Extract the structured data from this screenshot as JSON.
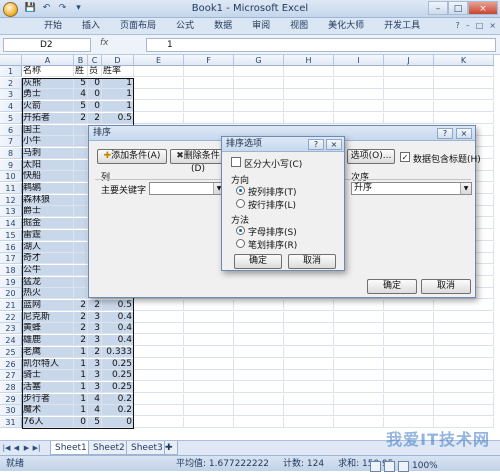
{
  "window": {
    "title": "Book1 - Microsoft Excel",
    "controls": [
      "–",
      "□",
      "×"
    ]
  },
  "qat": [
    "💾",
    "↶",
    "↷",
    "▾"
  ],
  "ribbon": {
    "tabs": [
      "开始",
      "插入",
      "页面布局",
      "公式",
      "数据",
      "审阅",
      "视图",
      "美化大师",
      "开发工具"
    ],
    "right_icons": [
      "?",
      "–",
      "□",
      "×"
    ]
  },
  "formula_bar": {
    "name_box": "D2",
    "fx": "fx",
    "value": "1"
  },
  "sheet": {
    "columns": [
      "A",
      "B",
      "C",
      "D",
      "E",
      "F",
      "G",
      "H",
      "I",
      "J",
      "K"
    ],
    "header_row": [
      "名称",
      "胜",
      "员",
      "胜率"
    ],
    "rows": [
      [
        "灰熊",
        "5",
        "0",
        "1"
      ],
      [
        "勇士",
        "4",
        "0",
        "1"
      ],
      [
        "火箭",
        "5",
        "0",
        "1"
      ],
      [
        "开拓者",
        "2",
        "2",
        "0.5"
      ],
      [
        "国王",
        "",
        "",
        ""
      ],
      [
        "小牛",
        "",
        "",
        ""
      ],
      [
        "马刺",
        "",
        "",
        ""
      ],
      [
        "太阳",
        "",
        "",
        ""
      ],
      [
        "快船",
        "",
        "",
        ""
      ],
      [
        "鹈鹕",
        "",
        "",
        ""
      ],
      [
        "森林狼",
        "",
        "",
        ""
      ],
      [
        "爵士",
        "",
        "",
        ""
      ],
      [
        "掘金",
        "",
        "",
        ""
      ],
      [
        "雷霆",
        "",
        "",
        ""
      ],
      [
        "湖人",
        "",
        "",
        ""
      ],
      [
        "奇才",
        "",
        "",
        ""
      ],
      [
        "公牛",
        "",
        "",
        ""
      ],
      [
        "猛龙",
        "",
        "",
        ""
      ],
      [
        "热火",
        "",
        "",
        ""
      ],
      [
        "篮网",
        "2",
        "2",
        "0.5"
      ],
      [
        "尼克斯",
        "2",
        "3",
        "0.4"
      ],
      [
        "黄蜂",
        "2",
        "3",
        "0.4"
      ],
      [
        "雄鹿",
        "2",
        "3",
        "0.4"
      ],
      [
        "老鹰",
        "1",
        "2",
        "0.333"
      ],
      [
        "凯尔特人",
        "1",
        "3",
        "0.25"
      ],
      [
        "骑士",
        "1",
        "3",
        "0.25"
      ],
      [
        "活塞",
        "1",
        "3",
        "0.25"
      ],
      [
        "步行者",
        "1",
        "4",
        "0.2"
      ],
      [
        "魔术",
        "1",
        "4",
        "0.2"
      ],
      [
        "76人",
        "0",
        "5",
        "0"
      ]
    ],
    "tabs": [
      "Sheet1",
      "Sheet2",
      "Sheet3"
    ]
  },
  "status": {
    "mode": "就绪",
    "average": "平均值: 1.677222222",
    "count": "计数: 124",
    "sum": "求和: 150.95",
    "zoom": "100%"
  },
  "sort_dialog": {
    "title": "排序",
    "add_level": "添加条件(A)",
    "delete_level": "删除条件(D)",
    "options": "选项(O)...",
    "has_headers": "数据包含标题(H)",
    "col_header": "列",
    "order_header": "次序",
    "primary_key": "主要关键字",
    "order_value": "升序",
    "ok": "确定",
    "cancel": "取消"
  },
  "options_dialog": {
    "title": "排序选项",
    "case_sensitive": "区分大小写(C)",
    "direction_label": "方向",
    "by_column": "按列排序(T)",
    "by_row": "按行排序(L)",
    "method_label": "方法",
    "alphabetical": "字母排序(S)",
    "stroke": "笔划排序(R)",
    "ok": "确定",
    "cancel": "取消"
  },
  "watermark": "我爱IT技术网"
}
